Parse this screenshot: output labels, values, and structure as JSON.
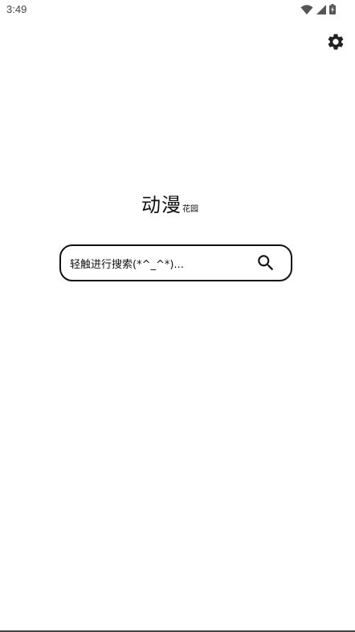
{
  "status_bar": {
    "time": "3:49",
    "icons": [
      "wifi-icon",
      "cellular-signal-icon",
      "battery-charging-icon"
    ]
  },
  "toolbar": {
    "settings_icon": "gear-icon"
  },
  "brand": {
    "title": "动漫",
    "subtitle": "花园"
  },
  "search": {
    "placeholder": "轻触进行搜索(*^_^*)...",
    "search_icon": "search-icon"
  },
  "colors": {
    "text": "#111111",
    "background": "#ffffff",
    "status_text": "#444444",
    "border": "#111111"
  }
}
